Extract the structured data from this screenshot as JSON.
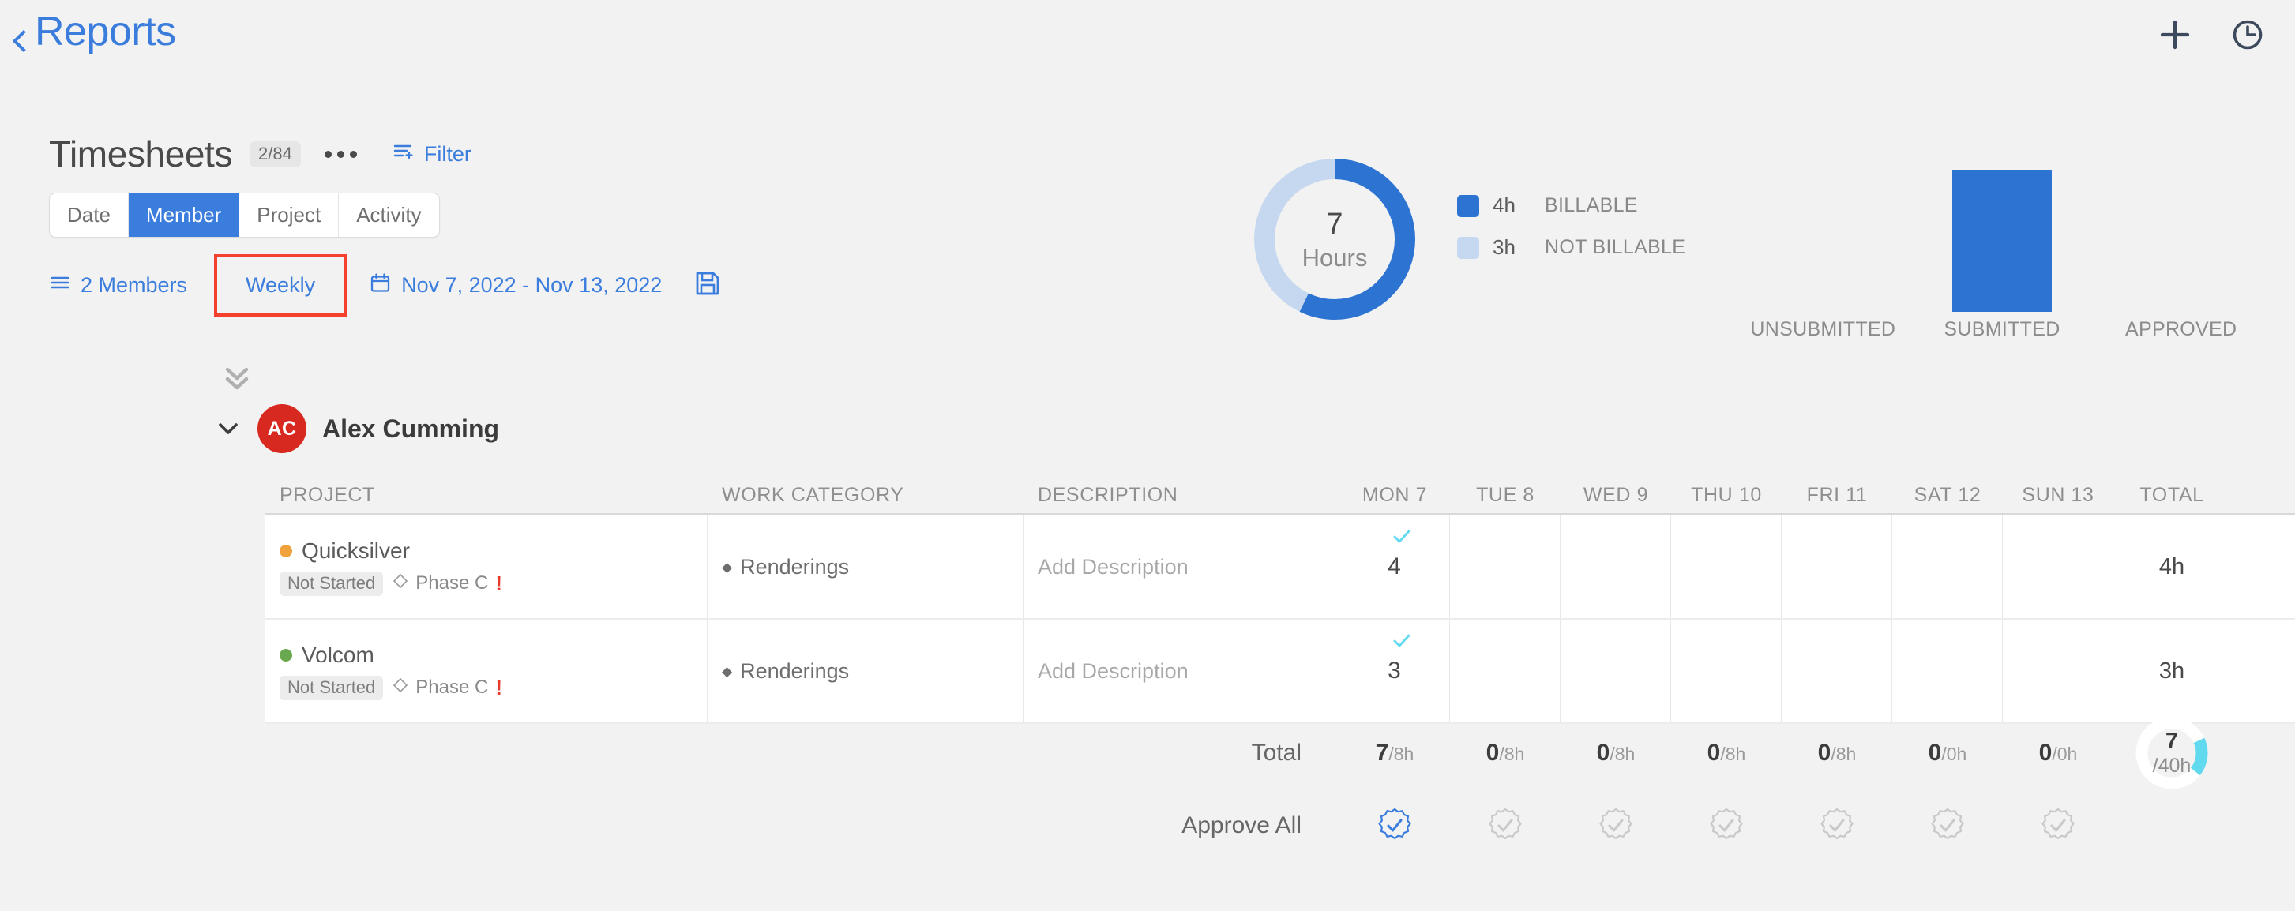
{
  "topbar": {
    "back_label": "Reports",
    "add_icon": "plus-icon",
    "time_icon": "clock-icon"
  },
  "header": {
    "title": "Timesheets",
    "count": "2/84",
    "more_icon": "ellipsis-icon",
    "filter_label": "Filter",
    "filter_icon": "filter-icon"
  },
  "group_tabs": {
    "items": [
      {
        "label": "Date",
        "active": false
      },
      {
        "label": "Member",
        "active": true
      },
      {
        "label": "Project",
        "active": false
      },
      {
        "label": "Activity",
        "active": false
      }
    ]
  },
  "filters": {
    "members_label": "2 Members",
    "members_icon": "list-icon",
    "period_label": "Weekly",
    "period_highlighted": true,
    "date_range": "Nov 7, 2022 - Nov 13, 2022",
    "calendar_icon": "calendar-icon",
    "save_icon": "save-icon"
  },
  "member": {
    "initials": "AC",
    "name": "Alex Cumming",
    "avatar_color": "#d7291f",
    "expanded": true
  },
  "colors": {
    "accent_blue": "#3b7ddd",
    "chart_blue": "#2d73d2",
    "chart_light_blue": "#c6d8f0",
    "cyan": "#61d9ee",
    "highlight_red": "#f4402c"
  },
  "table": {
    "headers": {
      "project": "PROJECT",
      "work_category": "WORK CATEGORY",
      "description": "DESCRIPTION",
      "days": [
        "MON 7",
        "TUE 8",
        "WED 9",
        "THU 10",
        "FRI 11",
        "SAT 12",
        "SUN 13"
      ],
      "total": "TOTAL"
    },
    "rows": [
      {
        "project": "Quicksilver",
        "project_dot_color": "#f0a23c",
        "status_badge": "Not Started",
        "phase": "Phase C",
        "phase_icon": "diamond-icon",
        "warning": "!",
        "work_category": "Renderings",
        "description_placeholder": "Add Description",
        "days": [
          "4",
          "",
          "",
          "",
          "",
          "",
          ""
        ],
        "day_checked": [
          true,
          false,
          false,
          false,
          false,
          false,
          false
        ],
        "total": "4h"
      },
      {
        "project": "Volcom",
        "project_dot_color": "#6aa84f",
        "status_badge": "Not Started",
        "phase": "Phase C",
        "phase_icon": "diamond-icon",
        "warning": "!",
        "work_category": "Renderings",
        "description_placeholder": "Add Description",
        "days": [
          "3",
          "",
          "",
          "",
          "",
          "",
          ""
        ],
        "day_checked": [
          true,
          false,
          false,
          false,
          false,
          false,
          false
        ],
        "total": "3h"
      }
    ],
    "totals": {
      "label": "Total",
      "cells": [
        {
          "value": "7",
          "capacity": "/8h"
        },
        {
          "value": "0",
          "capacity": "/8h"
        },
        {
          "value": "0",
          "capacity": "/8h"
        },
        {
          "value": "0",
          "capacity": "/8h"
        },
        {
          "value": "0",
          "capacity": "/8h"
        },
        {
          "value": "0",
          "capacity": "/0h"
        },
        {
          "value": "0",
          "capacity": "/0h"
        }
      ],
      "grand_value": "7",
      "grand_capacity": "/40h"
    },
    "approve": {
      "label": "Approve All",
      "states": [
        true,
        false,
        false,
        false,
        false,
        false,
        false
      ]
    }
  },
  "chart_data": [
    {
      "type": "pie",
      "title": "Hours Breakdown",
      "center_value": "7",
      "center_label": "Hours",
      "labels": [
        "BILLABLE",
        "NOT BILLABLE"
      ],
      "values": [
        4,
        3
      ],
      "value_labels": [
        "4h",
        "3h"
      ],
      "colors": [
        "#2d73d2",
        "#c6d8f0"
      ],
      "legend": "right",
      "total": 7,
      "unit": "h"
    },
    {
      "type": "bar",
      "title": "Timesheet Status",
      "categories": [
        "UNSUBMITTED",
        "SUBMITTED",
        "APPROVED"
      ],
      "values": [
        0,
        7,
        0
      ],
      "ylim": [
        0,
        7
      ],
      "color": "#2d73d2",
      "xlabel": "",
      "ylabel": "",
      "grid": false
    },
    {
      "type": "pie",
      "title": "Week Total Progress",
      "center_value": "7",
      "center_label": "/40h",
      "values": [
        7,
        33
      ],
      "colors": [
        "#61d9ee",
        "#ffffff"
      ],
      "total": 40,
      "unit": "h"
    }
  ]
}
